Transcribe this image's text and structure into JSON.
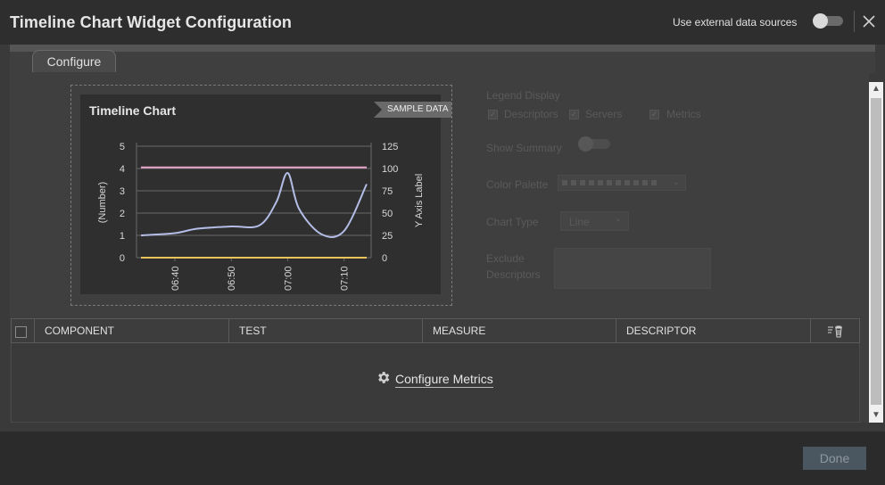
{
  "header": {
    "title": "Timeline Chart Widget Configuration",
    "external_label": "Use external data sources"
  },
  "tabs": [
    {
      "label": "Configure"
    }
  ],
  "preview": {
    "chart_title": "Timeline Chart",
    "badge": "SAMPLE DATA"
  },
  "chart_data": {
    "type": "line",
    "title": "Timeline Chart",
    "ylabel": "(Number)",
    "y2label": "Y Axis Label",
    "ylim": [
      0,
      5
    ],
    "y2lim": [
      0,
      125
    ],
    "yticks": [
      "0",
      "1",
      "2",
      "3",
      "4",
      "5"
    ],
    "y2ticks": [
      "0",
      "25",
      "50",
      "75",
      "100",
      "125"
    ],
    "xticks": [
      "06:40",
      "06:50",
      "07:00",
      "07:10"
    ],
    "x": [
      "06:34",
      "06:40",
      "06:44",
      "06:50",
      "06:55",
      "06:58",
      "07:00",
      "07:02",
      "07:06",
      "07:10",
      "07:14"
    ],
    "series": [
      {
        "values": [
          4.05,
          4.05,
          4.05,
          4.05,
          4.05,
          4.05,
          4.05,
          4.05,
          4.05,
          4.05,
          4.05
        ],
        "color": "#e7a6c9"
      },
      {
        "values": [
          1.0,
          1.1,
          1.3,
          1.4,
          1.45,
          2.5,
          3.8,
          2.2,
          1.05,
          1.2,
          3.3
        ],
        "color": "#b3bde6"
      },
      {
        "values": [
          0.0,
          0.0,
          0.0,
          0.0,
          0.0,
          0.0,
          0.0,
          0.0,
          0.0,
          0.0,
          0.0
        ],
        "color": "#e8c45a"
      }
    ],
    "grid": true
  },
  "settings": {
    "legend_display": "Legend Display",
    "descriptors": "Descriptors",
    "servers": "Servers",
    "metrics": "Metrics",
    "show_summary": "Show Summary",
    "color_palette": "Color Palette",
    "chart_type": "Chart Type",
    "chart_type_value": "Line",
    "exclude_descriptors_1": "Exclude",
    "exclude_descriptors_2": "Descriptors"
  },
  "grid": {
    "columns": [
      "COMPONENT",
      "TEST",
      "MEASURE",
      "DESCRIPTOR"
    ]
  },
  "configure_metrics": "Configure Metrics",
  "footer": {
    "done": "Done"
  }
}
